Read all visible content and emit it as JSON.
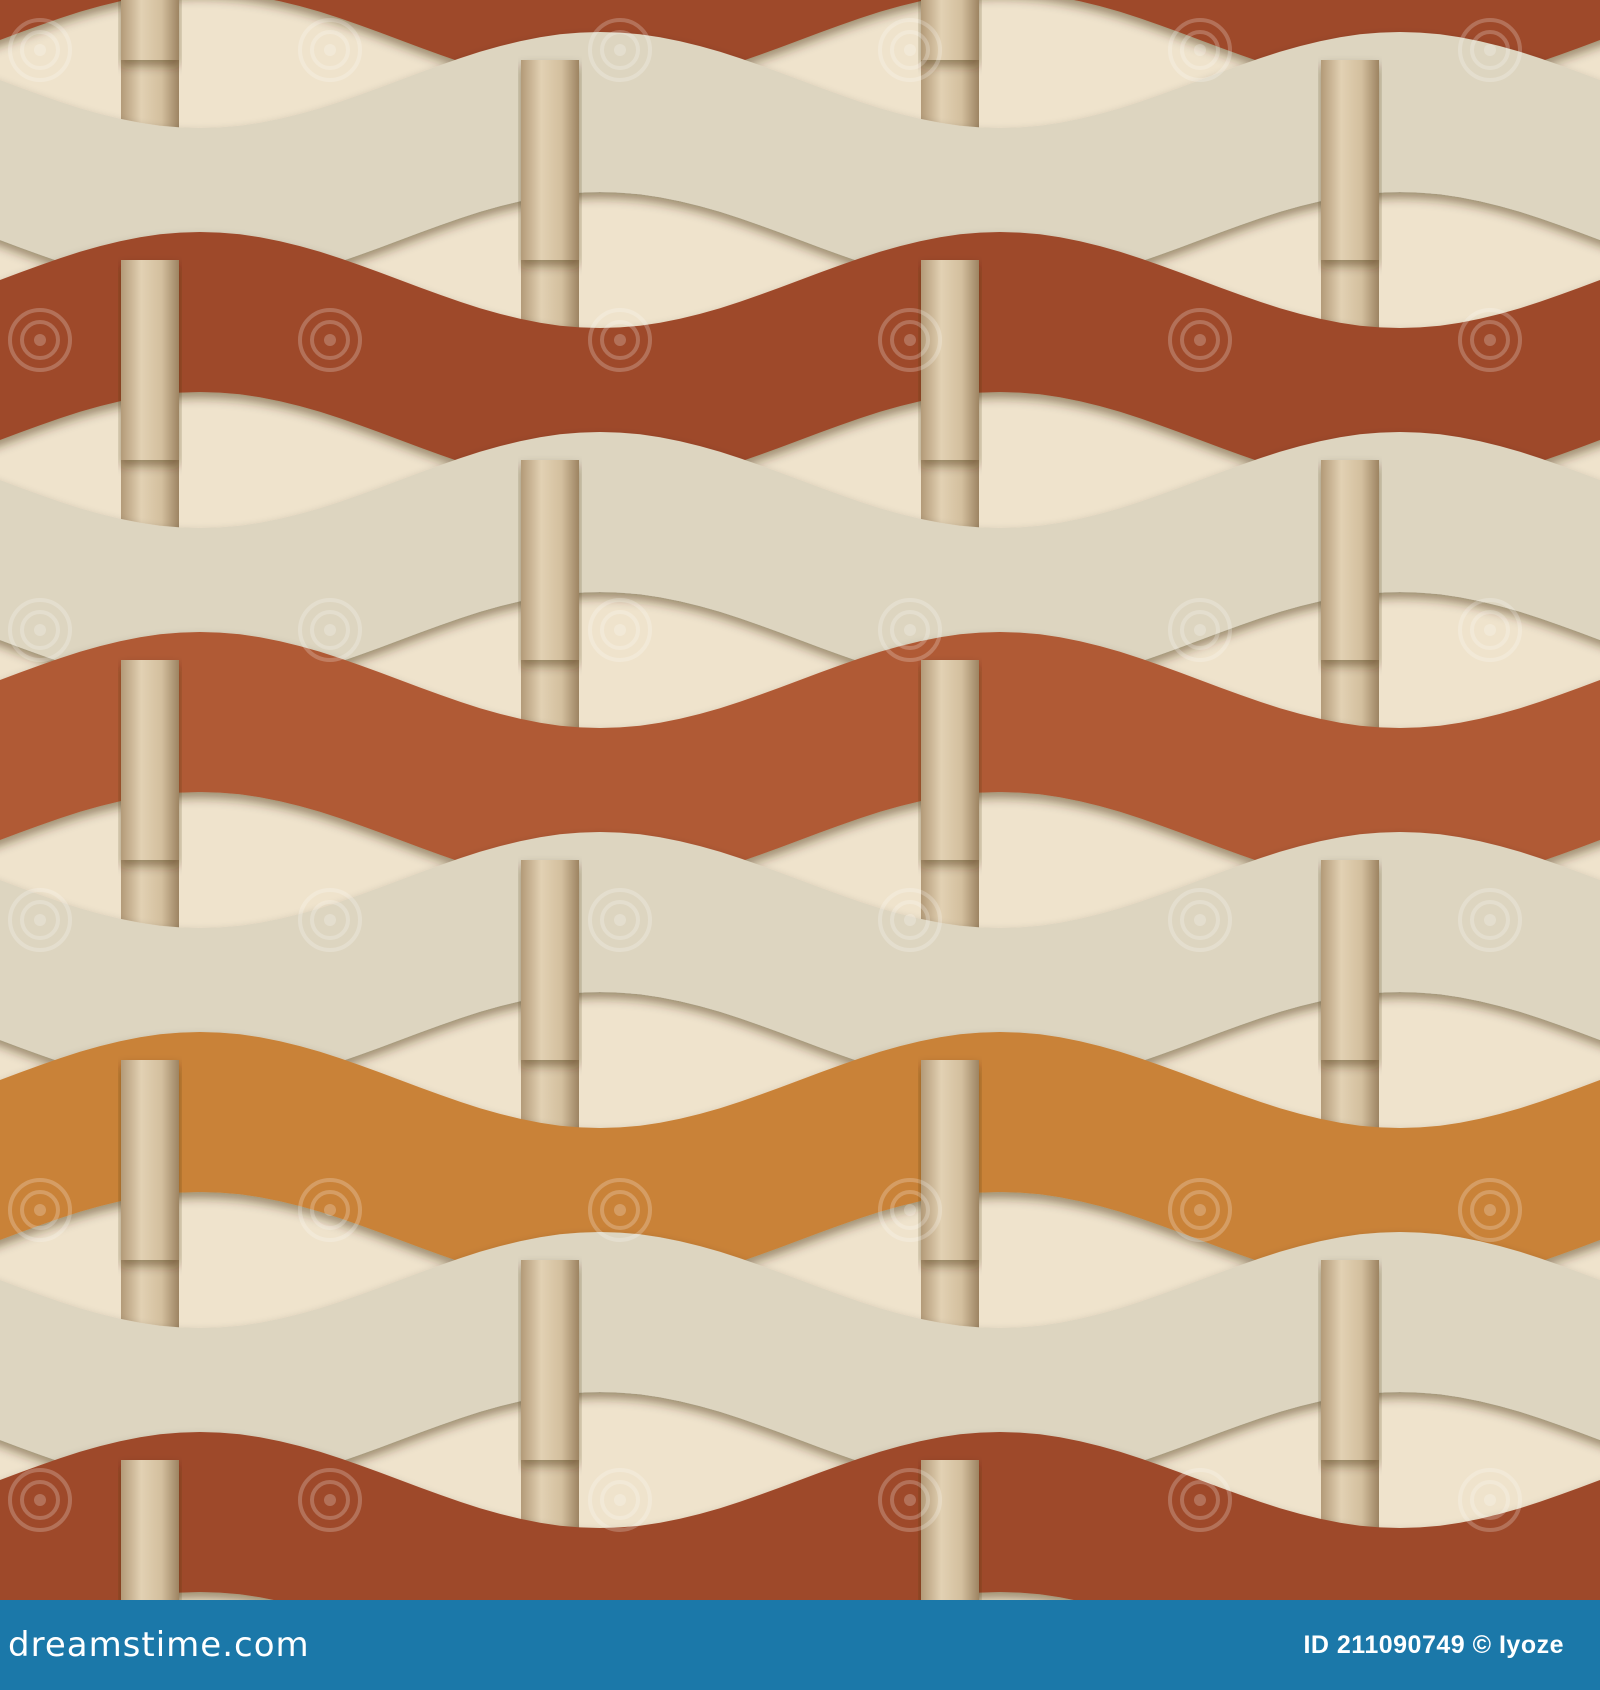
{
  "image": {
    "subject": "seamless woven wavy ribbon pattern",
    "colors": {
      "cream": "#ddd5c0",
      "rust": "#9e4a2c",
      "terracotta": "#b05a35",
      "orange": "#c98238",
      "rod": "#d4c0a0",
      "backing": "#efe3cc",
      "watermark": "#ffffff"
    },
    "rows_top_to_bottom": [
      "rust",
      "cream",
      "rust",
      "cream",
      "terracotta",
      "cream",
      "orange",
      "cream",
      "rust"
    ],
    "vertical_rods": 4,
    "watermark_icon": "spiral-watermark-icon"
  },
  "footer": {
    "brand": "dreamstime.com",
    "credit": "ID 211090749 © Iyoze",
    "background": "#1b78a9"
  }
}
